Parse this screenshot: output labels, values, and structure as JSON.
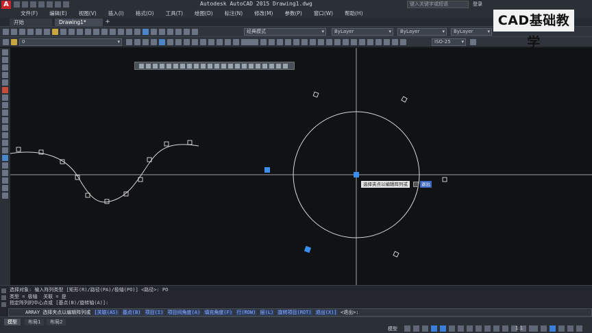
{
  "titlebar": {
    "title": "Autodesk AutoCAD 2015    Drawing1.dwg",
    "search_placeholder": "键入关键字或短语",
    "login": "登录"
  },
  "menu": [
    "文件(F)",
    "编辑(E)",
    "视图(V)",
    "插入(I)",
    "格式(O)",
    "工具(T)",
    "绘图(D)",
    "标注(N)",
    "修改(M)",
    "参数(P)",
    "窗口(W)",
    "帮助(H)"
  ],
  "tabs": [
    "开始",
    "Drawing1*"
  ],
  "toolbar2": {
    "workspace": "经典模式",
    "layer_color": "ByLayer",
    "linetype": "ByLayer",
    "lineweight": "ByLayer"
  },
  "toolbar3": {
    "layer": "0",
    "dimstyle": "ISO-25"
  },
  "tooltip": {
    "text": "选择夹点以编辑阵列或",
    "input": "退出"
  },
  "watermark": "CAD基础教学",
  "command": {
    "history": [
      "选择对象: 输入阵列类型 [矩形(R)/路径(PA)/极轴(PO)] <路径>: PO",
      "类型 = 极轴  关联 = 是",
      "指定阵列的中心点或 [基点(B)/旋转轴(A)]:"
    ],
    "prompt_prefix": "ARRAY 选择夹点以编辑阵列或",
    "options": [
      "[关联(AS)",
      "基点(B)",
      "项目(I)",
      "项目间角度(A)",
      "填充角度(F)",
      "行(ROW)",
      "层(L)",
      "旋转项目(ROT)",
      "退出(X)]"
    ],
    "prompt_suffix": "<退出>:"
  },
  "status": {
    "layout_tabs": [
      "模型",
      "布局1",
      "布局2"
    ],
    "model": "模型",
    "scale": "1:1"
  },
  "colors": {
    "grip_selected": "#3b8df0",
    "canvas": "#111214",
    "crosshair": "#d0d0d0"
  }
}
